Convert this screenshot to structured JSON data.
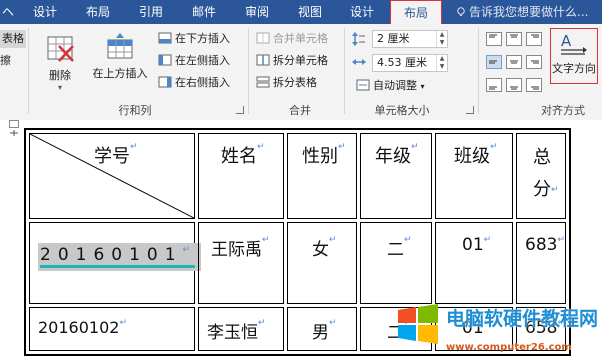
{
  "tabs": {
    "items": [
      "设计",
      "布局",
      "引用",
      "邮件",
      "审阅",
      "视图"
    ],
    "tool_design": "设计",
    "tool_layout": "布局",
    "tell_me": "告诉我您想要做什么..."
  },
  "ribbon": {
    "left_cut_1": "表格",
    "left_cut_2": "擦",
    "delete_label": "删除",
    "insert_above": "在上方插入",
    "insert_below": "在下方插入",
    "insert_left": "在左侧插入",
    "insert_right": "在右侧插入",
    "rows_cols_group": "行和列",
    "merge_cells": "合并单元格",
    "split_cells": "拆分单元格",
    "split_table": "拆分表格",
    "merge_group": "合并",
    "height_value": "2 厘米",
    "width_value": "4.53 厘米",
    "autofit": "自动调整",
    "cell_size_group": "单元格大小",
    "text_direction": "文字方向",
    "alignment_group": "对齐方式"
  },
  "table": {
    "header": {
      "student_id": "学号",
      "name": "姓名",
      "gender": "性别",
      "grade": "年级",
      "class": "班级",
      "total_1": "总",
      "total_2": "分"
    },
    "rows": [
      {
        "id": "20160101",
        "name": "王际禹",
        "gender": "女",
        "grade": "二",
        "class": "01",
        "total": "683"
      },
      {
        "id": "20160102",
        "name": "李玉恒",
        "gender": "男",
        "grade": "二",
        "class": "01",
        "total": "658"
      }
    ]
  },
  "watermark": {
    "text": "电脑软硬件教程网",
    "url": "www.computer26.com"
  },
  "colors": {
    "title_bar": "#2b579a",
    "highlight_border": "#d6333b",
    "selection": "#c8c8c8",
    "underline": "#1fb5b5"
  }
}
